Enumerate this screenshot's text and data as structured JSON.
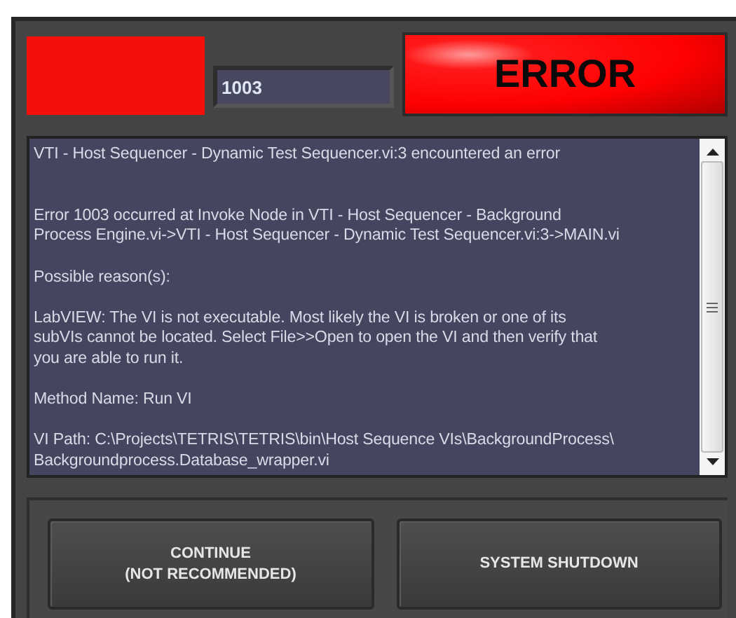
{
  "status_light": {
    "on": true
  },
  "error_code": {
    "value": "1003"
  },
  "error_indicator": {
    "label": "ERROR",
    "lit": true
  },
  "message": {
    "paragraphs": [
      {
        "lines": [
          "VTI - Host Sequencer - Dynamic Test Sequencer.vi:3 encountered an error"
        ]
      },
      {
        "lines": [
          "Error 1003 occurred at Invoke Node in VTI - Host Sequencer - Background",
          "Process Engine.vi->VTI - Host Sequencer - Dynamic Test Sequencer.vi:3->MAIN.vi"
        ]
      },
      {
        "lines": [
          "Possible reason(s):"
        ]
      },
      {
        "lines": [
          "LabVIEW:  The VI is not executable. Most likely the VI is broken or one of its",
          "subVIs cannot be located. Select File>>Open to open the VI and then verify that",
          "you are able to run it."
        ]
      },
      {
        "lines": [
          "Method Name: Run VI"
        ]
      },
      {
        "lines": [
          "VI Path: C:\\Projects\\TETRIS\\TETRIS\\bin\\Host Sequence VIs\\BackgroundProcess\\",
          "Backgroundprocess.Database_wrapper.vi"
        ]
      }
    ]
  },
  "buttons": [
    {
      "lines": [
        "CONTINUE",
        "(NOT RECOMMENDED)"
      ]
    },
    {
      "lines": [
        "SYSTEM SHUTDOWN"
      ]
    }
  ]
}
